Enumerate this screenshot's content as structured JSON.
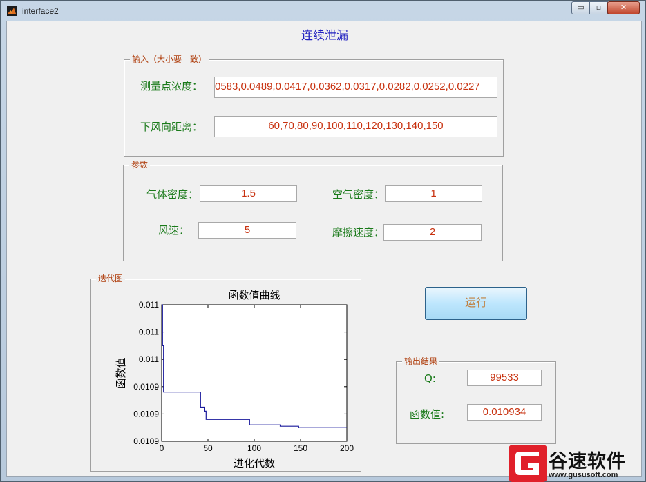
{
  "window": {
    "title": "interface2",
    "minimize": "▭",
    "maximize": "▫",
    "close": "✕"
  },
  "main_title": "连续泄漏",
  "input_panel": {
    "title": "输入（大小要一致）",
    "concentration_label": "测量点浓度：",
    "concentration_value": "0583,0.0489,0.0417,0.0362,0.0317,0.0282,0.0252,0.0227",
    "distance_label": "下风向距离：",
    "distance_value": "60,70,80,90,100,110,120,130,140,150"
  },
  "params_panel": {
    "title": "参数",
    "gas_density_label": "气体密度：",
    "gas_density_value": "1.5",
    "air_density_label": "空气密度：",
    "air_density_value": "1",
    "wind_speed_label": "风速：",
    "wind_speed_value": "5",
    "friction_speed_label": "摩擦速度：",
    "friction_speed_value": "2"
  },
  "chart_panel": {
    "title": "迭代图"
  },
  "run_button": {
    "label": "运行"
  },
  "output_panel": {
    "title": "输出结果",
    "q_label": "Q:",
    "q_value": "99533",
    "fval_label": "函数值:",
    "fval_value": "0.010934"
  },
  "logo": {
    "text": "谷速软件",
    "url": "www.gususoft.com",
    "color": "#e0202a"
  },
  "colors": {
    "label_green": "#1a7a1a",
    "value_red": "#c83210",
    "title_blue": "#2020c0",
    "panel_title": "#b04010",
    "line": "#1a1a9c"
  },
  "chart_data": {
    "type": "line",
    "title": "函数值曲线",
    "xlabel": "进化代数",
    "ylabel": "函数值",
    "xlim": [
      0,
      200
    ],
    "ylim": [
      0.01091,
      0.01101
    ],
    "x_ticks": [
      0,
      50,
      100,
      150,
      200
    ],
    "x_tick_labels": [
      "0",
      "50",
      "100",
      "150",
      "200"
    ],
    "y_ticks": [
      0.01091,
      0.01093,
      0.01095,
      0.01097,
      0.01099,
      0.01101
    ],
    "y_tick_labels": [
      "0.0109",
      "0.0109",
      "0.0109",
      "0.011",
      "0.011",
      "0.011"
    ],
    "series": [
      {
        "x": [
          0,
          1,
          1,
          2,
          2,
          42,
          42,
          46,
          46,
          48,
          48,
          95,
          95,
          128,
          128,
          148,
          148,
          200
        ],
        "y": [
          0.01101,
          0.01101,
          0.01098,
          0.01098,
          0.010946,
          0.010946,
          0.010935,
          0.010935,
          0.010932,
          0.010932,
          0.010926,
          0.010926,
          0.010922,
          0.010922,
          0.010921,
          0.010921,
          0.01092,
          0.01092
        ]
      }
    ]
  }
}
